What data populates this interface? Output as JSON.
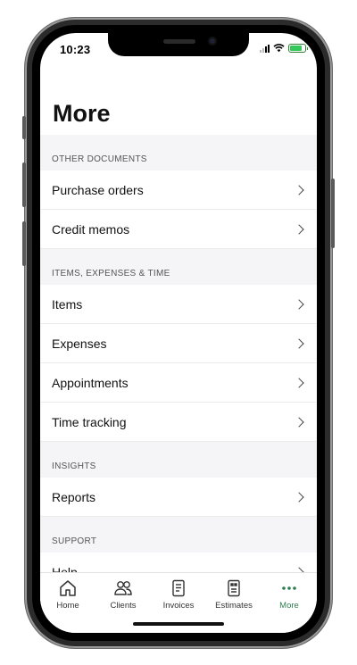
{
  "status_bar": {
    "time": "10:23"
  },
  "page": {
    "title": "More"
  },
  "sections": [
    {
      "header": "OTHER DOCUMENTS",
      "items": [
        "Purchase orders",
        "Credit memos"
      ]
    },
    {
      "header": "ITEMS, EXPENSES & TIME",
      "items": [
        "Items",
        "Expenses",
        "Appointments",
        "Time tracking"
      ]
    },
    {
      "header": "INSIGHTS",
      "items": [
        "Reports"
      ]
    },
    {
      "header": "SUPPORT",
      "items": [
        "Help"
      ]
    }
  ],
  "tab_bar": {
    "tabs": [
      {
        "label": "Home",
        "icon": "home-icon"
      },
      {
        "label": "Clients",
        "icon": "clients-icon"
      },
      {
        "label": "Invoices",
        "icon": "invoices-icon"
      },
      {
        "label": "Estimates",
        "icon": "estimates-icon"
      },
      {
        "label": "More",
        "icon": "more-dots-icon",
        "active": true
      }
    ]
  },
  "colors": {
    "accent": "#2e7d4f",
    "section_bg": "#f5f4f7"
  }
}
